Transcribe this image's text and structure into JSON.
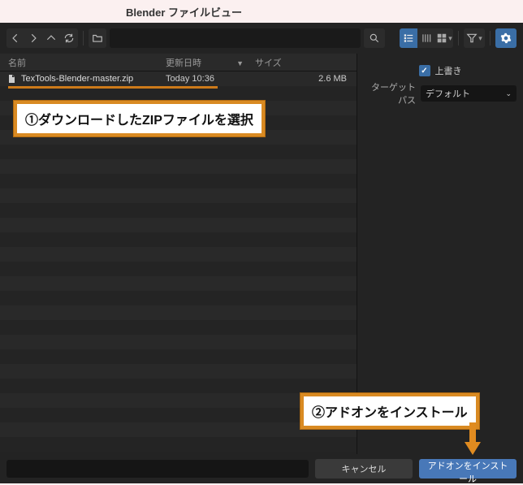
{
  "window_title": "Blender ファイルビュー",
  "toolbar": {
    "path_value": "",
    "search_icon": "search-icon"
  },
  "columns": {
    "name": "名前",
    "date": "更新日時",
    "size": "サイズ"
  },
  "files": [
    {
      "name": "TexTools-Blender-master.zip",
      "date": "Today 10:36",
      "size": "2.6 MB"
    }
  ],
  "sidepanel": {
    "overwrite_label": "上書き",
    "overwrite_checked": true,
    "target_path_label": "ターゲットパス",
    "target_path_value": "デフォルト"
  },
  "footer": {
    "filename_value": "",
    "cancel_label": "キャンセル",
    "install_label": "アドオンをインストール"
  },
  "annotations": {
    "step1": "①ダウンロードしたZIPファイルを選択",
    "step2": "②アドオンをインストール"
  },
  "colors": {
    "bg_dark": "#232323",
    "accent_blue": "#3a6ea6",
    "annotation_orange": "#d98a22"
  }
}
